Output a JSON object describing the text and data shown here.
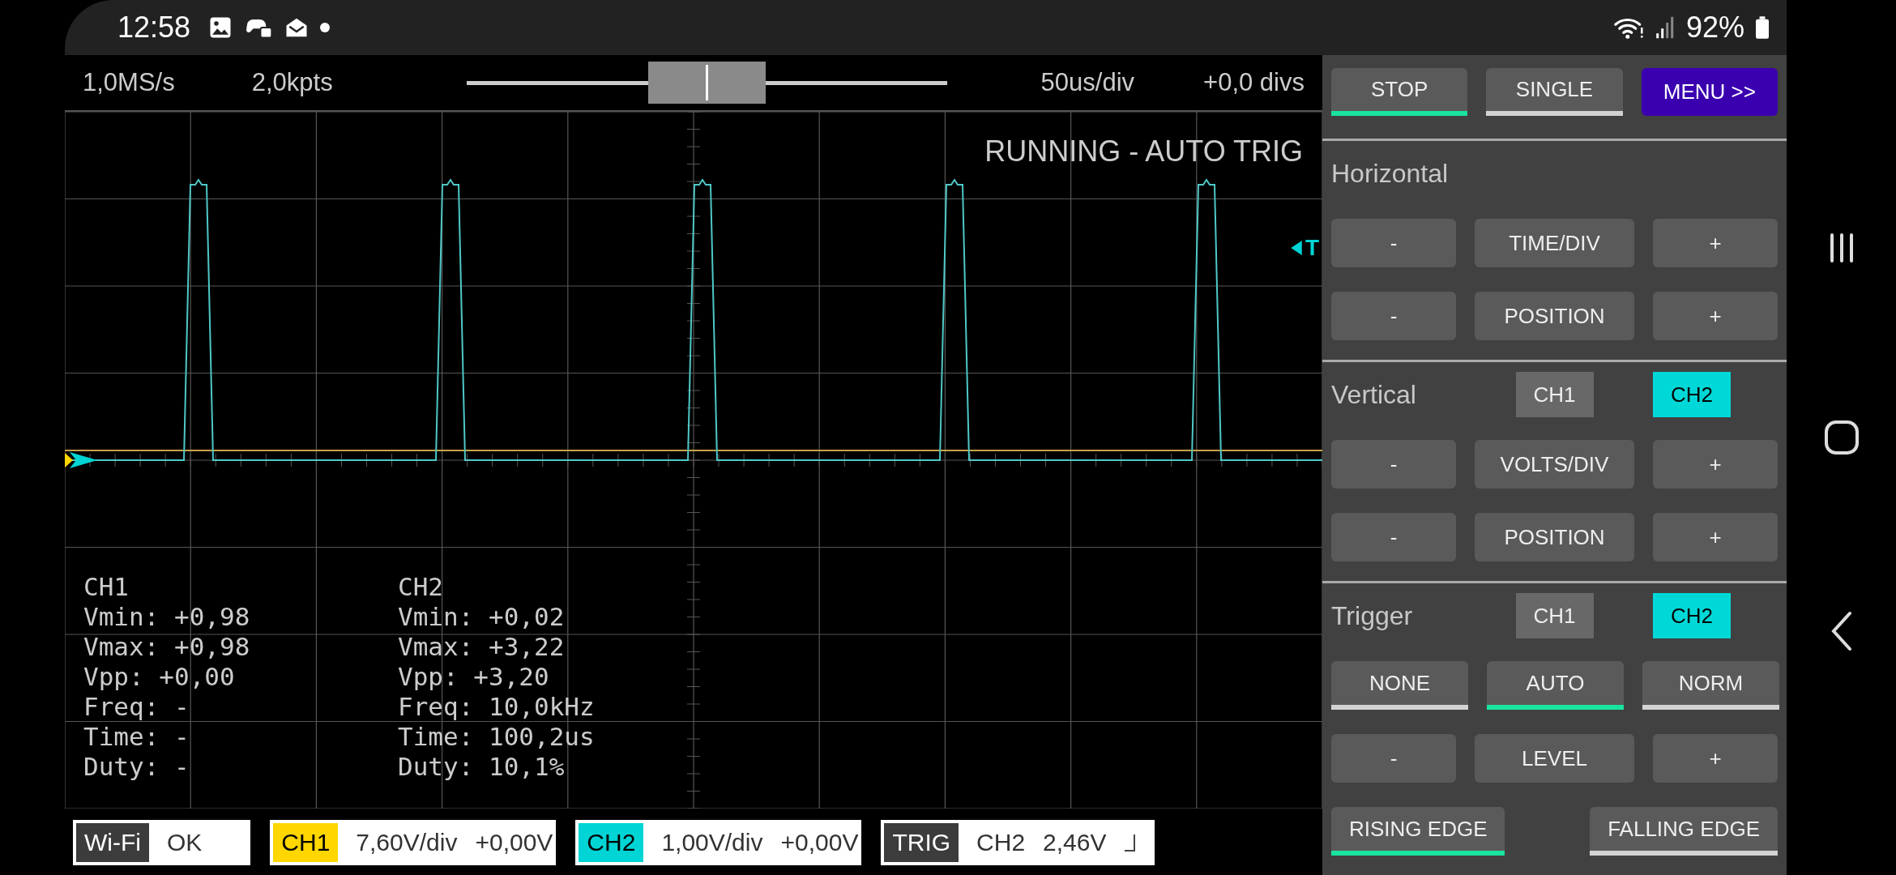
{
  "status_bar": {
    "time": "12:58",
    "battery": "92%"
  },
  "top_bar": {
    "sample_rate": "1,0MS/s",
    "points": "2,0kpts",
    "position_slider": {
      "level": 0.5
    },
    "timebase": "50us/div",
    "offset": "+0,0 divs"
  },
  "scope": {
    "status": "RUNNING - AUTO TRIG",
    "trigger_marker": "T",
    "measurements": [
      {
        "channel": "CH1",
        "lines": [
          "Vmin: +0,98",
          "Vmax: +0,98",
          "Vpp: +0,00",
          "Freq: -",
          "Time: -",
          "Duty: -"
        ]
      },
      {
        "channel": "CH2",
        "lines": [
          "Vmin: +0,02",
          "Vmax: +3,22",
          "Vpp: +3,20",
          "Freq: 10,0kHz",
          "Time: 100,2us",
          "Duty: 10,1%"
        ]
      }
    ]
  },
  "bottom_bar": [
    {
      "kind": "status",
      "tag": "Wi-Fi",
      "color": "#3c3c3c",
      "values": [
        "OK"
      ]
    },
    {
      "kind": "channel",
      "tag": "CH1",
      "color": "#ffd600",
      "values": [
        "7,60V/div",
        "+0,00V"
      ]
    },
    {
      "kind": "channel",
      "tag": "CH2",
      "color": "#00d4d4",
      "values": [
        "1,00V/div",
        "+0,00V"
      ]
    },
    {
      "kind": "trigger",
      "tag": "TRIG",
      "color": "#3c3c3c",
      "values": [
        "CH2",
        "2,46V"
      ]
    }
  ],
  "panel": {
    "run_buttons": [
      {
        "kind": "toggle",
        "label": "STOP",
        "selected": true
      },
      {
        "kind": "toggle",
        "label": "SINGLE",
        "selected": false
      },
      {
        "kind": "menu",
        "label": "MENU >>"
      }
    ],
    "sections": [
      {
        "title": "Horizontal",
        "rows": [
          [
            "-",
            "TIME/DIV",
            "+"
          ],
          [
            "-",
            "POSITION",
            "+"
          ]
        ]
      },
      {
        "title": "Vertical",
        "channels": [
          {
            "label": "CH1",
            "selected": false
          },
          {
            "label": "CH2",
            "selected": true
          }
        ],
        "rows": [
          [
            "-",
            "VOLTS/DIV",
            "+"
          ],
          [
            "-",
            "POSITION",
            "+"
          ]
        ]
      },
      {
        "title": "Trigger",
        "channels": [
          {
            "label": "CH1",
            "selected": false
          },
          {
            "label": "CH2",
            "selected": true
          }
        ],
        "modes": [
          {
            "label": "NONE",
            "selected": false
          },
          {
            "label": "AUTO",
            "selected": true
          },
          {
            "label": "NORM",
            "selected": false
          }
        ],
        "rows": [
          [
            "-",
            "LEVEL",
            "+"
          ]
        ],
        "edges": [
          {
            "label": "RISING EDGE",
            "selected": true
          },
          {
            "label": "FALLING EDGE",
            "selected": false
          }
        ]
      }
    ]
  }
}
